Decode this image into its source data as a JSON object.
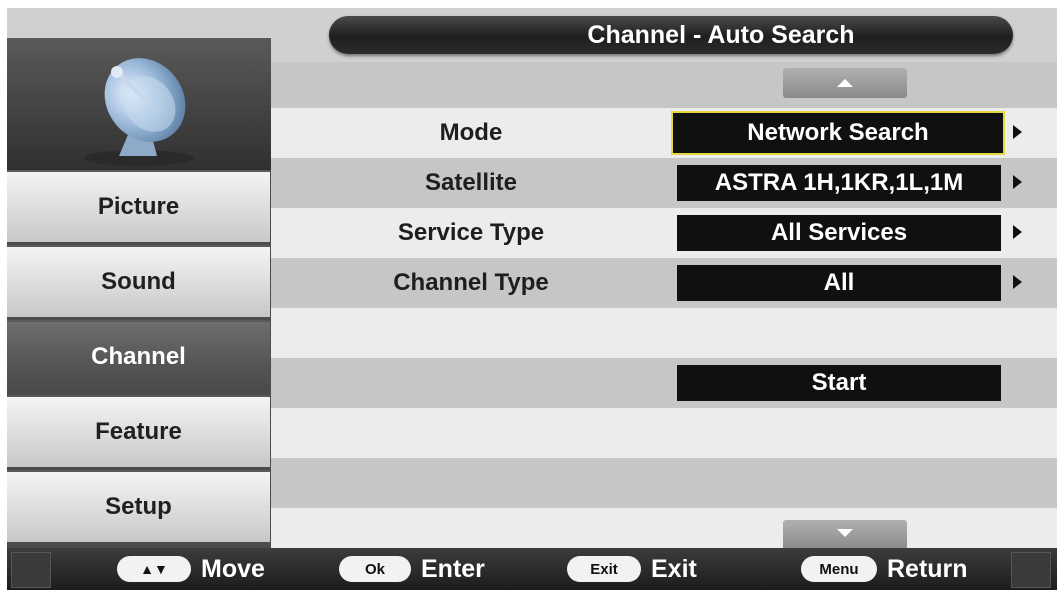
{
  "title": "Channel - Auto Search",
  "sidebar": {
    "icon": "satellite-dish-icon",
    "items": [
      {
        "label": "Picture",
        "active": false
      },
      {
        "label": "Sound",
        "active": false
      },
      {
        "label": "Channel",
        "active": true
      },
      {
        "label": "Feature",
        "active": false
      },
      {
        "label": "Setup",
        "active": false
      }
    ]
  },
  "settings": [
    {
      "label": "Mode",
      "value": "Network Search"
    },
    {
      "label": "Satellite",
      "value": "ASTRA 1H,1KR,1L,1M"
    },
    {
      "label": "Service Type",
      "value": "All Services"
    },
    {
      "label": "Channel Type",
      "value": "All"
    }
  ],
  "start_label": "Start",
  "footer": {
    "move": {
      "key": "▲▼",
      "label": "Move"
    },
    "enter": {
      "key": "Ok",
      "label": "Enter"
    },
    "exit": {
      "key": "Exit",
      "label": "Exit"
    },
    "return": {
      "key": "Menu",
      "label": "Return"
    }
  },
  "colors": {
    "focus_border": "#e8d640",
    "value_box": "#101010",
    "active_tab": "#555555"
  }
}
